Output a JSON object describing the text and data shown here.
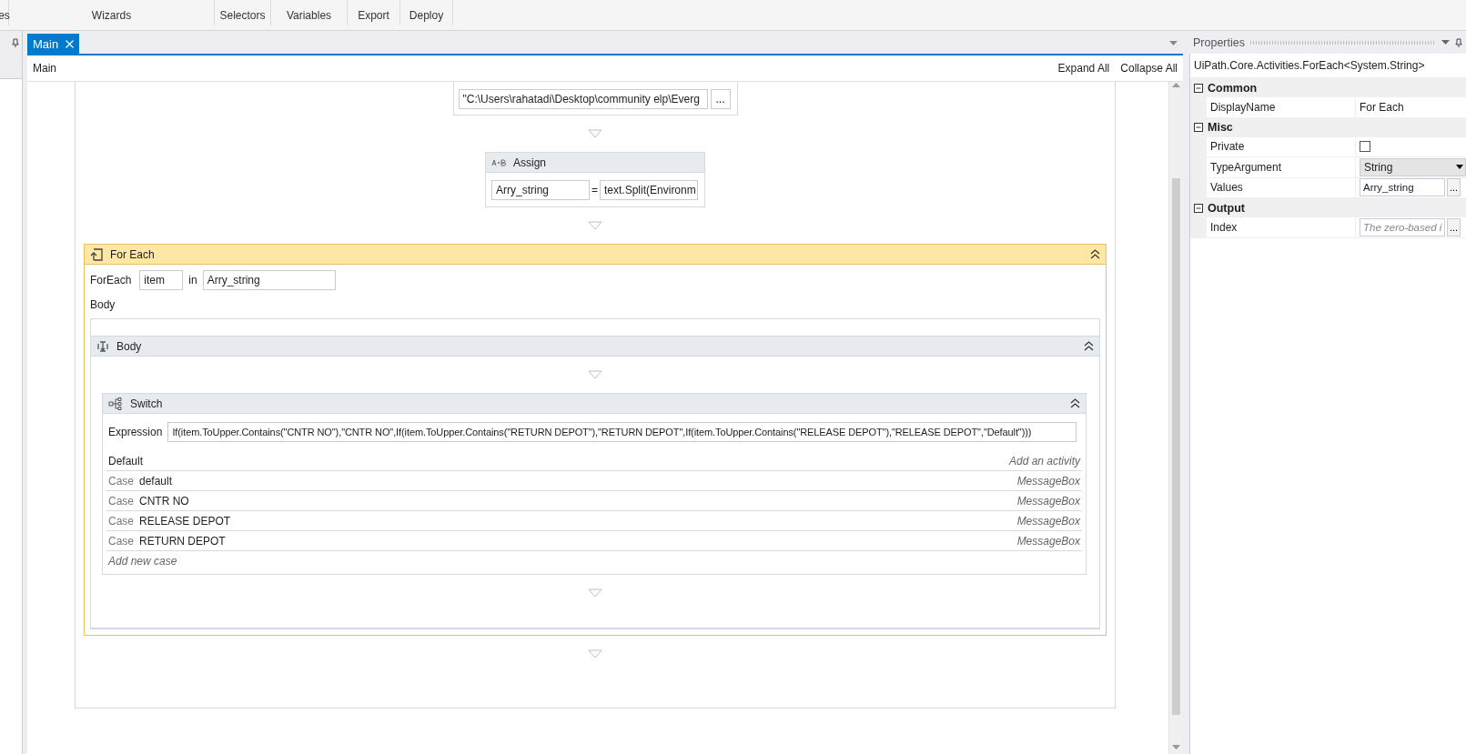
{
  "ribbon": {
    "groups": [
      {
        "label": "es"
      },
      {
        "label": "Wizards"
      },
      {
        "label": "Selectors"
      },
      {
        "label": "Variables"
      },
      {
        "label": "Export"
      },
      {
        "label": "Deploy"
      }
    ]
  },
  "document_tabs": [
    {
      "label": "Main",
      "selected": true
    }
  ],
  "breadcrumb": "Main",
  "designer_actions": [
    "Expand All",
    "Collapse All"
  ],
  "workflow": {
    "file_activity": {
      "path": "\"C:\\Users\\rahatadi\\Desktop\\community elp\\Everg",
      "browse_button": "..."
    },
    "assign": {
      "title": "Assign",
      "to": "Arry_string",
      "operator": "=",
      "value": "text.Split(Environm"
    },
    "for_each": {
      "title": "For Each",
      "keyword": "ForEach",
      "item": "item",
      "in_label": "in",
      "values": "Arry_string",
      "body_label": "Body",
      "body": {
        "title": "Body",
        "switch": {
          "title": "Switch",
          "expression_label": "Expression",
          "expression": "If(item.ToUpper.Contains(\"CNTR NO\"),\"CNTR NO\",If(item.ToUpper.Contains(\"RETURN DEPOT\"),\"RETURN DEPOT\",If(item.ToUpper.Contains(\"RELEASE DEPOT\"),\"RELEASE DEPOT\",\"Default\")))",
          "default_label": "Default",
          "default_hint": "Add an activity",
          "cases": [
            {
              "case_label": "Case",
              "value": "default",
              "activity": "MessageBox"
            },
            {
              "case_label": "Case",
              "value": "CNTR NO",
              "activity": "MessageBox"
            },
            {
              "case_label": "Case",
              "value": "RELEASE DEPOT",
              "activity": "MessageBox"
            },
            {
              "case_label": "Case",
              "value": "RETURN DEPOT",
              "activity": "MessageBox"
            }
          ],
          "add_case": "Add new case"
        }
      }
    }
  },
  "properties": {
    "title": "Properties",
    "type_name": "UiPath.Core.Activities.ForEach<System.String>",
    "categories": [
      {
        "name": "Common",
        "expanded": true,
        "rows": [
          {
            "name": "DisplayName",
            "kind": "text",
            "value": "For Each"
          }
        ]
      },
      {
        "name": "Misc",
        "expanded": true,
        "rows": [
          {
            "name": "Private",
            "kind": "checkbox",
            "checked": false
          },
          {
            "name": "TypeArgument",
            "kind": "dropdown",
            "value": "String"
          },
          {
            "name": "Values",
            "kind": "field",
            "value": "Arry_string",
            "button": "..."
          }
        ]
      },
      {
        "name": "Output",
        "expanded": true,
        "rows": [
          {
            "name": "Index",
            "kind": "field",
            "placeholder": "The zero-based i",
            "button": "..."
          }
        ]
      }
    ]
  }
}
